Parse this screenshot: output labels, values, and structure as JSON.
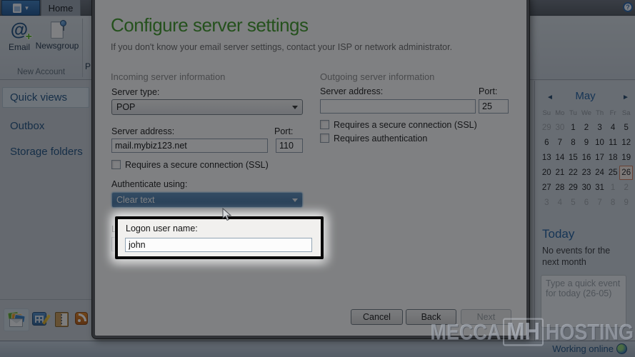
{
  "chrome": {
    "home_tab_label": "Home",
    "new_account_group": "New Account",
    "partial_button_label": "P"
  },
  "ribbon": {
    "email_label": "Email",
    "newsgroup_label": "Newsgroup"
  },
  "sidebar": {
    "items": [
      {
        "label": "Quick views",
        "selected": true
      },
      {
        "label": "Outbox",
        "selected": false
      },
      {
        "label": "Storage folders",
        "selected": false
      }
    ]
  },
  "dialog": {
    "title": "Configure server settings",
    "subtitle": "If you don't know your email server settings, contact your ISP or network administrator.",
    "incoming": {
      "header": "Incoming server information",
      "server_type_label": "Server type:",
      "server_type_value": "POP",
      "server_address_label": "Server address:",
      "server_address_value": "mail.mybiz123.net",
      "port_label": "Port:",
      "port_value": "110",
      "ssl_label": "Requires a secure connection (SSL)",
      "auth_label": "Authenticate using:",
      "auth_value": "Clear text",
      "logon_label": "Logon user name:",
      "logon_value": "john"
    },
    "outgoing": {
      "header": "Outgoing server information",
      "server_address_label": "Server address:",
      "server_address_value": "",
      "port_label": "Port:",
      "port_value": "25",
      "ssl_label": "Requires a secure connection (SSL)",
      "auth_label": "Requires authentication"
    },
    "buttons": {
      "cancel": "Cancel",
      "back": "Back",
      "next": "Next"
    }
  },
  "calendar": {
    "month": "May",
    "prev_arrow": "◄",
    "next_arrow": "►",
    "weekdays": [
      "Su",
      "Mo",
      "Tu",
      "We",
      "Th",
      "Fr",
      "Sa"
    ],
    "days": [
      {
        "d": "29",
        "m": 1
      },
      {
        "d": "30",
        "m": 1
      },
      {
        "d": "1"
      },
      {
        "d": "2"
      },
      {
        "d": "3"
      },
      {
        "d": "4"
      },
      {
        "d": "5"
      },
      {
        "d": "6"
      },
      {
        "d": "7"
      },
      {
        "d": "8"
      },
      {
        "d": "9"
      },
      {
        "d": "10"
      },
      {
        "d": "11"
      },
      {
        "d": "12"
      },
      {
        "d": "13"
      },
      {
        "d": "14"
      },
      {
        "d": "15"
      },
      {
        "d": "16"
      },
      {
        "d": "17"
      },
      {
        "d": "18"
      },
      {
        "d": "19"
      },
      {
        "d": "20"
      },
      {
        "d": "21"
      },
      {
        "d": "22"
      },
      {
        "d": "23"
      },
      {
        "d": "24"
      },
      {
        "d": "25"
      },
      {
        "d": "26",
        "sel": 1
      },
      {
        "d": "27"
      },
      {
        "d": "28"
      },
      {
        "d": "29"
      },
      {
        "d": "30"
      },
      {
        "d": "31"
      },
      {
        "d": "1",
        "m": 1
      },
      {
        "d": "2",
        "m": 1
      },
      {
        "d": "3",
        "m": 1
      },
      {
        "d": "4",
        "m": 1
      },
      {
        "d": "5",
        "m": 1
      },
      {
        "d": "6",
        "m": 1
      },
      {
        "d": "7",
        "m": 1
      },
      {
        "d": "8",
        "m": 1
      },
      {
        "d": "9",
        "m": 1
      }
    ],
    "selected_day": "26"
  },
  "today_panel": {
    "title": "Today",
    "no_events": "No events for the next month",
    "quick_event_placeholder": "Type a quick event for today (26-05)"
  },
  "status_bar": {
    "working_online": "Working online"
  },
  "watermark": {
    "left": "MECCA",
    "logo": "MH",
    "right": "HOSTING"
  },
  "colors": {
    "title_green": "#3f9928",
    "link_blue": "#1d4f80",
    "selected_day_border": "#cf7a5a",
    "app_menu_blue": "#2a67ae"
  }
}
